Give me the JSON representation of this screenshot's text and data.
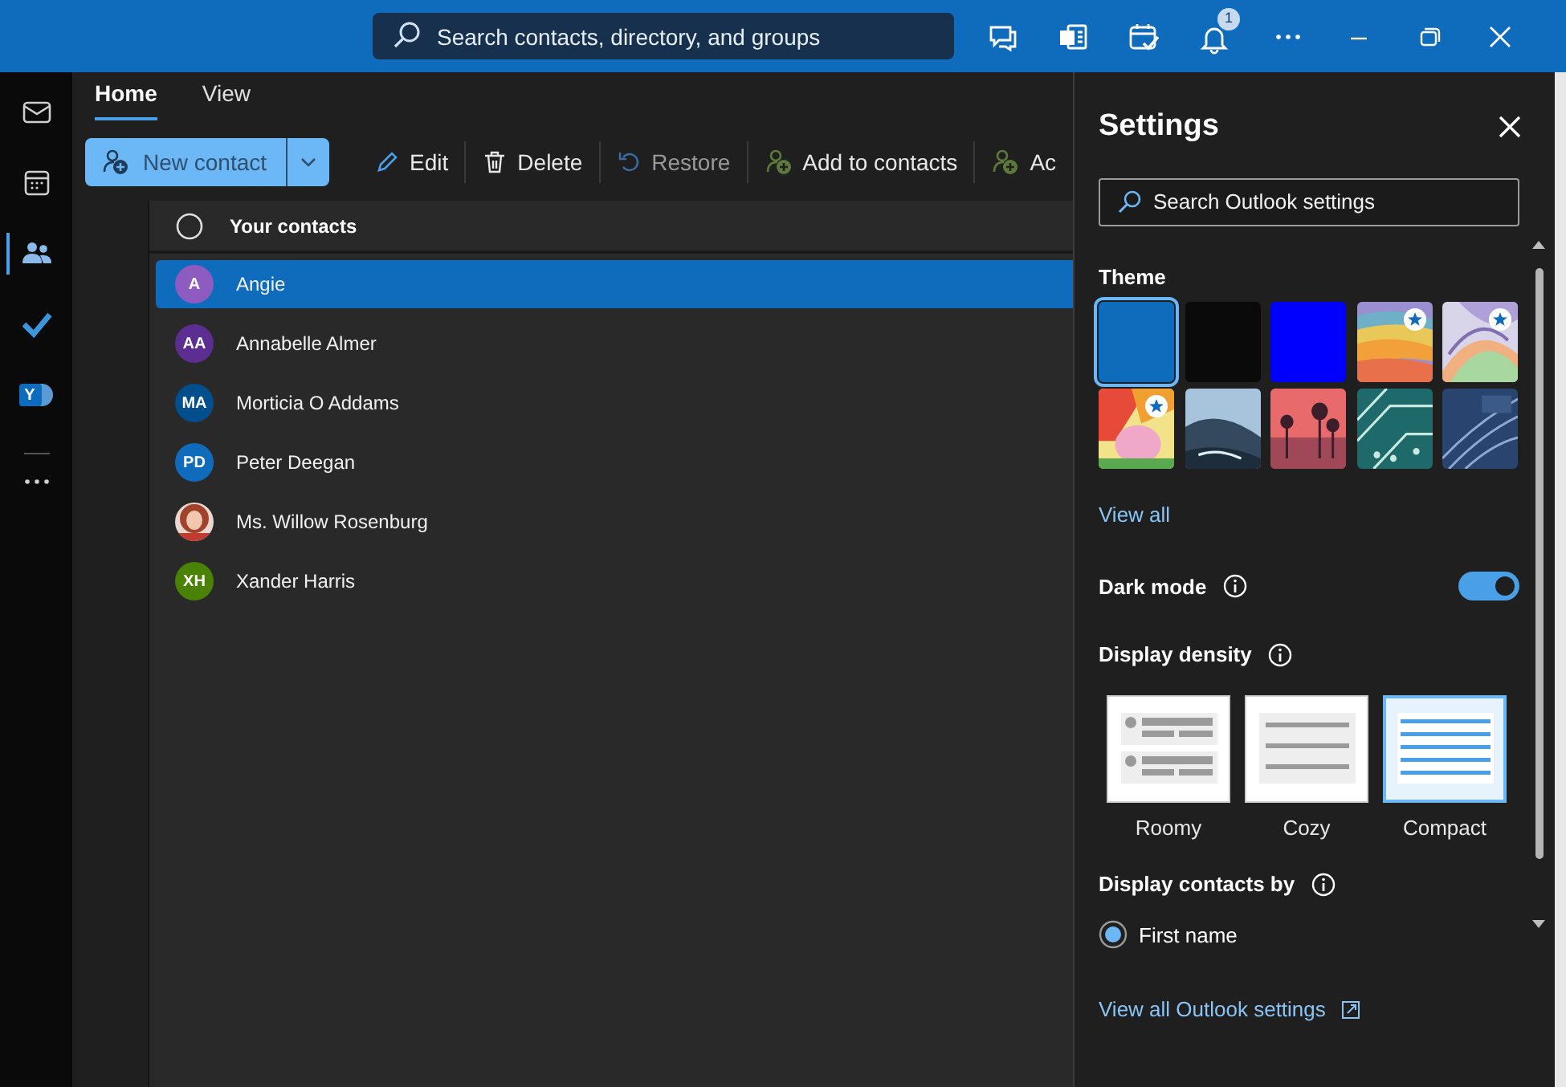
{
  "title_bar": {
    "search_placeholder": "Search contacts, directory, and groups",
    "notification_count": "1"
  },
  "rail": [
    {
      "kind": "mail",
      "selected": false
    },
    {
      "kind": "calendar",
      "selected": false
    },
    {
      "kind": "people",
      "selected": true
    },
    {
      "kind": "todo",
      "selected": false
    },
    {
      "kind": "yammer",
      "label": "Y",
      "selected": false
    },
    {
      "kind": "more",
      "selected": false
    }
  ],
  "tabs": [
    {
      "label": "Home",
      "selected": true
    },
    {
      "label": "View",
      "selected": false
    }
  ],
  "toolbar": {
    "new_contact": "New contact",
    "actions": [
      {
        "kind": "edit",
        "label": "Edit",
        "disabled": false
      },
      {
        "kind": "delete",
        "label": "Delete",
        "disabled": false
      },
      {
        "kind": "restore",
        "label": "Restore",
        "disabled": true
      },
      {
        "kind": "add",
        "label": "Add to contacts",
        "disabled": false
      },
      {
        "kind": "add",
        "label": "Ac",
        "disabled": false
      }
    ]
  },
  "contacts": {
    "header": "Your contacts",
    "all_checked": false,
    "rows": [
      {
        "name": "Angie",
        "initials": "A",
        "color": "#8e5bc0",
        "selected": true
      },
      {
        "name": "Annabelle Almer",
        "initials": "AA",
        "color": "#5c2e91",
        "selected": false
      },
      {
        "name": "Morticia O Addams",
        "initials": "MA",
        "color": "#004e8c",
        "selected": false
      },
      {
        "name": "Peter Deegan",
        "initials": "PD",
        "color": "#0f6cbd",
        "selected": false
      },
      {
        "name": "Ms. Willow Rosenburg",
        "kind": "picture",
        "selected": false
      },
      {
        "name": "Xander Harris",
        "initials": "XH",
        "color": "#498205",
        "selected": false
      }
    ]
  },
  "settings": {
    "title": "Settings",
    "search_placeholder": "Search Outlook settings",
    "theme_label": "Theme",
    "themes": [
      {
        "kind": "color",
        "color": "#0f6cbd",
        "selected": true,
        "premium": false
      },
      {
        "kind": "color",
        "color": "#0a0a0a",
        "selected": false,
        "premium": false
      },
      {
        "kind": "color",
        "color": "#0000ff",
        "selected": false,
        "premium": false
      },
      {
        "kind": "picture",
        "selected": false,
        "premium": true
      },
      {
        "kind": "picture",
        "selected": false,
        "premium": true
      },
      {
        "kind": "picture",
        "selected": false,
        "premium": true
      },
      {
        "kind": "picture",
        "selected": false,
        "premium": false
      },
      {
        "kind": "picture",
        "selected": false,
        "premium": false
      },
      {
        "kind": "picture",
        "selected": false,
        "premium": false
      },
      {
        "kind": "picture",
        "selected": false,
        "premium": false
      }
    ],
    "view_all": "View all",
    "dark_mode": {
      "label": "Dark mode",
      "on": true
    },
    "density": {
      "label": "Display density",
      "options": [
        {
          "kind": "roomy",
          "label": "Roomy",
          "selected": false
        },
        {
          "kind": "cozy",
          "label": "Cozy",
          "selected": false
        },
        {
          "kind": "compact",
          "label": "Compact",
          "selected": true
        }
      ]
    },
    "display_by": {
      "label": "Display contacts by",
      "options": [
        {
          "label": "First name",
          "selected": true
        }
      ]
    },
    "footer_link": "View all Outlook settings"
  }
}
